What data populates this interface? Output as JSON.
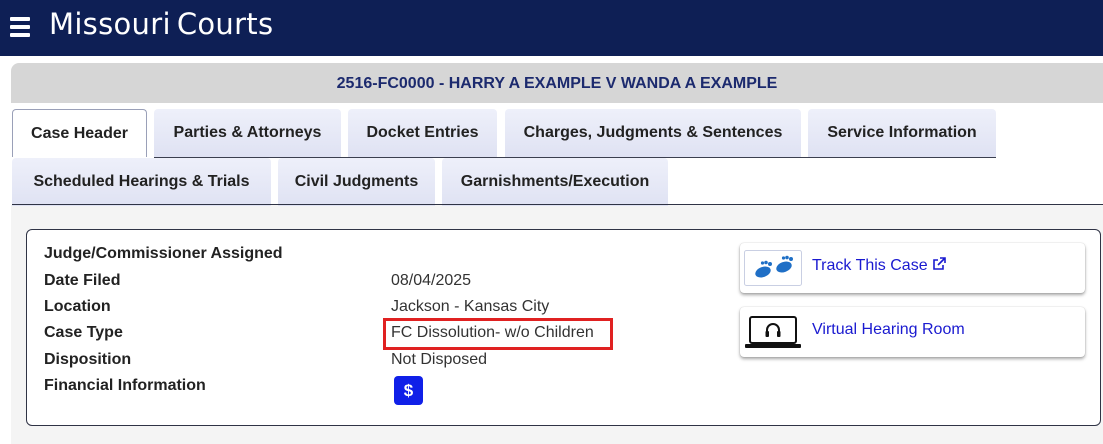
{
  "header": {
    "brand_word1": "Missouri",
    "brand_word2": "Courts"
  },
  "case": {
    "caption": "2516-FC0000 - HARRY A EXAMPLE V WANDA A EXAMPLE"
  },
  "tabs": [
    {
      "label": "Case Header",
      "active": true
    },
    {
      "label": "Parties & Attorneys"
    },
    {
      "label": "Docket Entries"
    },
    {
      "label": "Charges, Judgments & Sentences"
    },
    {
      "label": "Service Information"
    },
    {
      "label": "Scheduled Hearings & Trials"
    },
    {
      "label": "Civil Judgments"
    },
    {
      "label": "Garnishments/Execution"
    }
  ],
  "details": {
    "judge_label": "Judge/Commissioner Assigned",
    "date_filed_label": "Date Filed",
    "date_filed_value": "08/04/2025",
    "location_label": "Location",
    "location_value": "Jackson - Kansas City",
    "case_type_label": "Case Type",
    "case_type_value": "FC Dissolution- w/o Children",
    "disposition_label": "Disposition",
    "disposition_value": "Not Disposed",
    "financial_label": "Financial Information",
    "financial_button": "$"
  },
  "side_links": {
    "track_label": "Track This Case",
    "virtual_label": "Virtual Hearing Room"
  },
  "colors": {
    "topbar": "#0e1f55",
    "caption_text": "#1c2a6e",
    "link": "#1a1ad0",
    "highlight": "#e02121",
    "financial_button": "#1020e8"
  },
  "icons": [
    "menu-icon",
    "footprints-icon",
    "external-link-icon",
    "laptop-headset-icon"
  ]
}
